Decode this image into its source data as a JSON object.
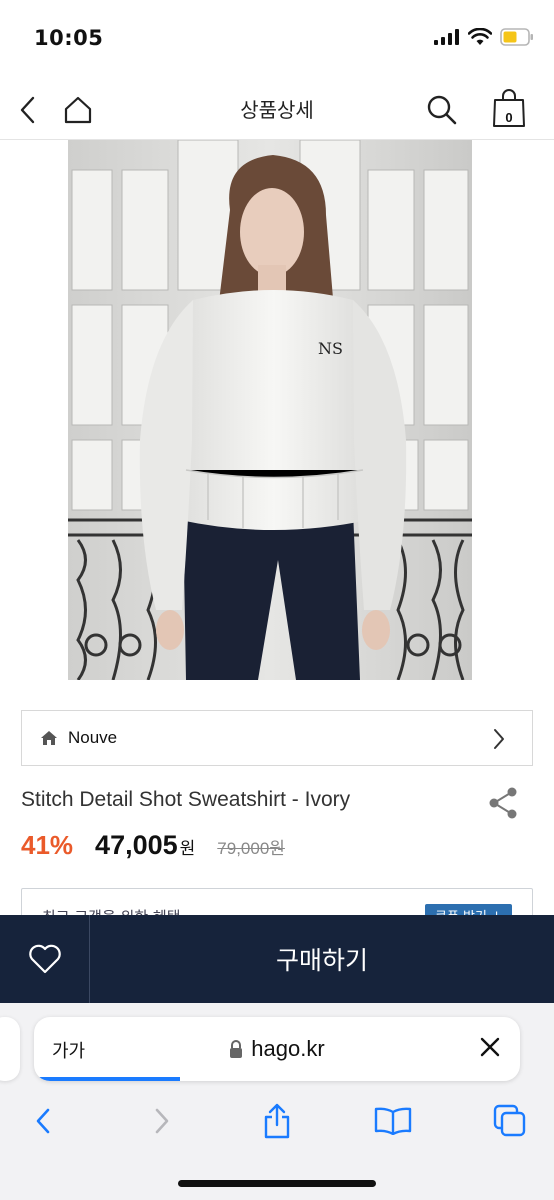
{
  "status": {
    "time": "10:05"
  },
  "header": {
    "title": "상품상세",
    "cart_count": "0"
  },
  "brand": {
    "name": "Nouve"
  },
  "product": {
    "name": "Stitch Detail Shot Sweatshirt - Ivory",
    "discount": "41%",
    "price": "47,005",
    "currency": "원",
    "original_price": "79,000원"
  },
  "coupon": {
    "text": "최고 고객을 위한 혜택",
    "button": "쿠폰 받기 ↓"
  },
  "buy_bar": {
    "buy_label": "구매하기"
  },
  "browser": {
    "aa": "가가",
    "url": "hago.kr",
    "load_progress": 0.3
  },
  "colors": {
    "accent_discount": "#ea5a2a",
    "buy_bar": "#16233b",
    "safari_blue": "#1a7bff"
  }
}
